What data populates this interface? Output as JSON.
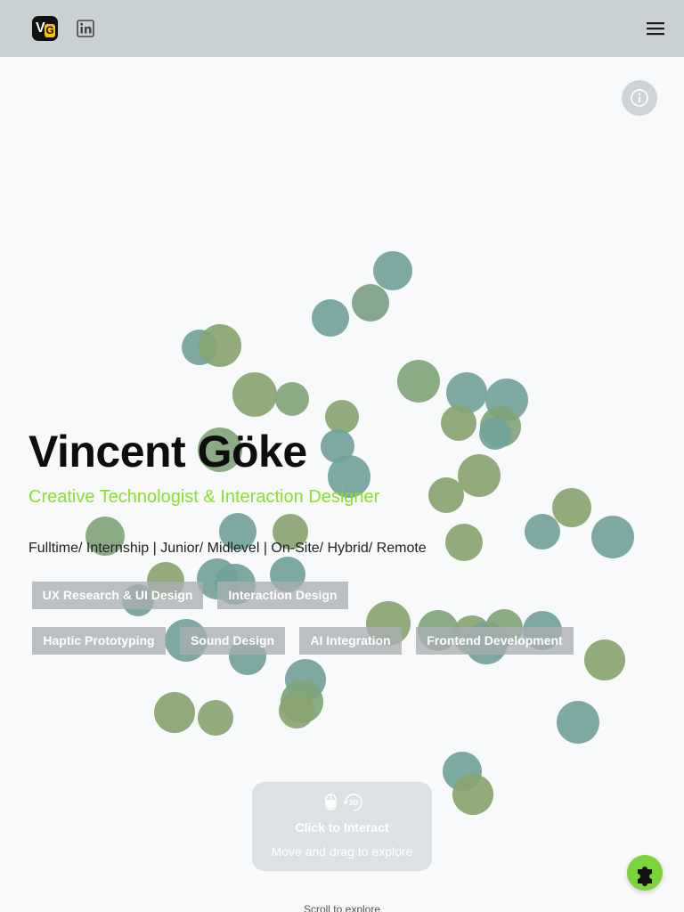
{
  "header": {
    "logo": {
      "letter_v": "V",
      "letter_g": "G",
      "icon": "vg-logo-icon"
    },
    "linkedin_icon": "linkedin-icon",
    "menu_icon": "hamburger-menu-icon"
  },
  "info_button": {
    "icon": "info-icon"
  },
  "hero": {
    "name": "Vincent Göke",
    "role": "Creative Technologist & Interaction Designer",
    "availability": "Fulltime/ Internship | Junior/ Midlevel | On-Site/ Hybrid/ Remote",
    "tags": [
      "UX Research & UI Design",
      "Interaction Design",
      "Haptic Prototyping",
      "Sound Design",
      "AI Integration",
      "Frontend Development"
    ]
  },
  "interact_prompt": {
    "icons": [
      "mouse-icon",
      "3d-rotate-icon"
    ],
    "icon_3d_text": "3D",
    "title": "Click to Interact",
    "subtitle": "Move and drag to explore"
  },
  "scroll_hint": "Scroll to explore",
  "puzzle_button": {
    "icon": "puzzle-icon"
  },
  "colors": {
    "accent": "#8ae02a",
    "header_bg": "#c9d1d4",
    "bubble_green": "#88a470",
    "bubble_teal": "#72a29a",
    "tag_bg": "#aaaeb2",
    "puzzle_bg": "#7bd43b"
  }
}
